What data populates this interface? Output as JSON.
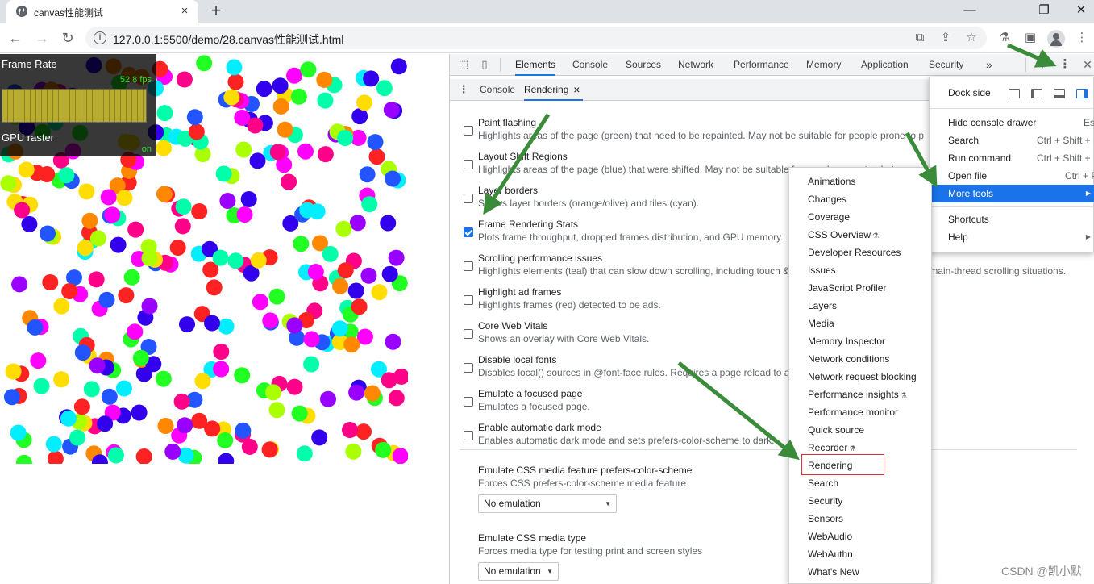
{
  "browser": {
    "tab_title": "canvas性能测试",
    "tab_close": "×",
    "new_tab": "+",
    "url": "127.0.0.1:5500/demo/28.canvas性能测试.html",
    "window_minimize": "—",
    "window_restore": "❐",
    "window_close": "✕"
  },
  "fps_meter": {
    "title": "Frame Rate",
    "fps": "52.8 fps",
    "gpu_title": "GPU raster",
    "gpu_state": "on"
  },
  "devtools": {
    "tabs": [
      "Elements",
      "Console",
      "Sources",
      "Network",
      "Performance",
      "Memory",
      "Application",
      "Security"
    ],
    "overflow": "»",
    "drawer_tabs": [
      "Console",
      "Rendering"
    ],
    "drawer_close": "×",
    "rendering_options": [
      {
        "label": "Paint flashing",
        "desc": "Highlights areas of the page (green) that need to be repainted. May not be suitable for people prone to p",
        "checked": false
      },
      {
        "label": "Layout Shift Regions",
        "desc": "Highlights areas of the page (blue) that were shifted. May not be suitable for people prone to photosens",
        "checked": false
      },
      {
        "label": "Layer borders",
        "desc": "Shows layer borders (orange/olive) and tiles (cyan).",
        "checked": false
      },
      {
        "label": "Frame Rendering Stats",
        "desc": "Plots frame throughput, dropped frames distribution, and GPU memory.",
        "checked": true
      },
      {
        "label": "Scrolling performance issues",
        "desc": "Highlights elements (teal) that can slow down scrolling, including touch & wheel event handlers and other main-thread scrolling situations.",
        "checked": false
      },
      {
        "label": "Highlight ad frames",
        "desc": "Highlights frames (red) detected to be ads.",
        "checked": false
      },
      {
        "label": "Core Web Vitals",
        "desc": "Shows an overlay with Core Web Vitals.",
        "checked": false
      },
      {
        "label": "Disable local fonts",
        "desc": "Disables local() sources in @font-face rules. Requires a page reload to apply.",
        "checked": false
      },
      {
        "label": "Emulate a focused page",
        "desc": "Emulates a focused page.",
        "checked": false
      },
      {
        "label": "Enable automatic dark mode",
        "desc": "Enables automatic dark mode and sets prefers-color-scheme to dark.",
        "checked": false
      }
    ],
    "emulations": [
      {
        "label": "Emulate CSS media feature prefers-color-scheme",
        "desc": "Forces CSS prefers-color-scheme media feature",
        "value": "No emulation"
      },
      {
        "label": "Emulate CSS media type",
        "desc": "Forces media type for testing print and screen styles",
        "value": "No emulation"
      }
    ]
  },
  "main_menu": {
    "dock_side": "Dock side",
    "items": [
      {
        "label": "Hide console drawer",
        "shortcut": "Esc"
      },
      {
        "label": "Search",
        "shortcut": "Ctrl + Shift + F"
      },
      {
        "label": "Run command",
        "shortcut": "Ctrl + Shift + P"
      },
      {
        "label": "Open file",
        "shortcut": "Ctrl + P"
      },
      {
        "label": "More tools",
        "shortcut": "",
        "submenu": true
      },
      {
        "label": "Shortcuts",
        "shortcut": ""
      },
      {
        "label": "Help",
        "shortcut": "",
        "submenu": true
      }
    ]
  },
  "more_tools": [
    {
      "label": "Animations",
      "experimental": false
    },
    {
      "label": "Changes",
      "experimental": false
    },
    {
      "label": "Coverage",
      "experimental": false
    },
    {
      "label": "CSS Overview",
      "experimental": true
    },
    {
      "label": "Developer Resources",
      "experimental": false
    },
    {
      "label": "Issues",
      "experimental": false
    },
    {
      "label": "JavaScript Profiler",
      "experimental": false
    },
    {
      "label": "Layers",
      "experimental": false
    },
    {
      "label": "Media",
      "experimental": false
    },
    {
      "label": "Memory Inspector",
      "experimental": false
    },
    {
      "label": "Network conditions",
      "experimental": false
    },
    {
      "label": "Network request blocking",
      "experimental": false
    },
    {
      "label": "Performance insights",
      "experimental": true
    },
    {
      "label": "Performance monitor",
      "experimental": false
    },
    {
      "label": "Quick source",
      "experimental": false
    },
    {
      "label": "Recorder",
      "experimental": true
    },
    {
      "label": "Rendering",
      "experimental": false,
      "highlighted": true
    },
    {
      "label": "Search",
      "experimental": false
    },
    {
      "label": "Security",
      "experimental": false
    },
    {
      "label": "Sensors",
      "experimental": false
    },
    {
      "label": "WebAudio",
      "experimental": false
    },
    {
      "label": "WebAuthn",
      "experimental": false
    },
    {
      "label": "What's New",
      "experimental": false
    }
  ],
  "watermark": "CSDN @凯小默",
  "colors": {
    "accent": "#1a73e8",
    "arrow": "#3a8c3a",
    "highlight_box": "#e0302d",
    "fps_text": "#2ee02e",
    "ball_palette": [
      "#ff2222",
      "#ff8800",
      "#ffdd00",
      "#aaff00",
      "#22ff22",
      "#00ffaa",
      "#00eeff",
      "#2255ff",
      "#3300ee",
      "#9900ff",
      "#ff00ff",
      "#ff0088"
    ]
  }
}
